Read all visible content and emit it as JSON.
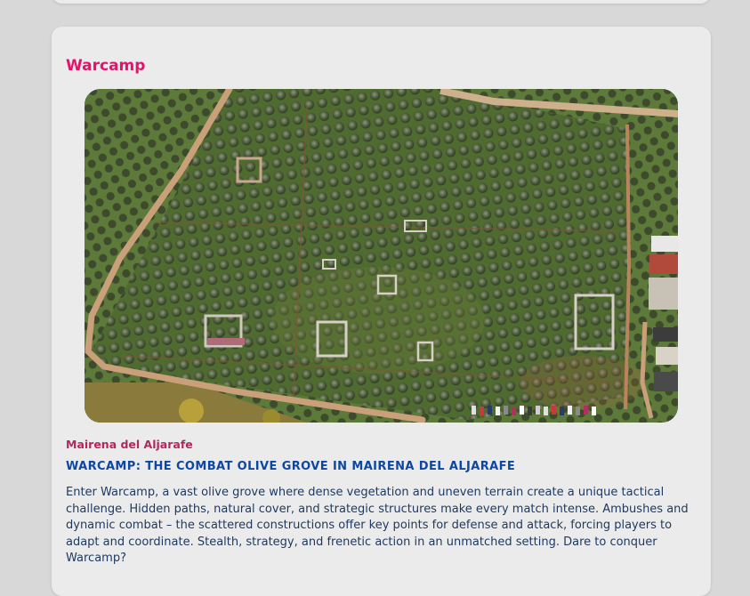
{
  "card": {
    "title": "Warcamp",
    "image_alt": "Aerial view of the Warcamp olive grove",
    "location": "Mairena del Aljarafe",
    "headline": "WARCAMP: THE COMBAT OLIVE GROVE IN MAIRENA DEL ALJARAFE",
    "description": "Enter Warcamp, a vast olive grove where dense vegetation and uneven terrain create a unique tactical challenge. Hidden paths, natural cover, and strategic structures make every match intense. Ambushes and dynamic combat – the scattered constructions offer key points for defense and attack, forcing players to adapt and coordinate. Stealth, strategy, and frenetic action in an unmatched setting. Dare to conquer Warcamp?"
  },
  "colors": {
    "title": "#e8106a",
    "location": "#b0285f",
    "headline": "#0d47a1",
    "body_text": "#1f3a60",
    "card_bg": "#ebebeb",
    "page_bg": "#d8d8d8"
  }
}
